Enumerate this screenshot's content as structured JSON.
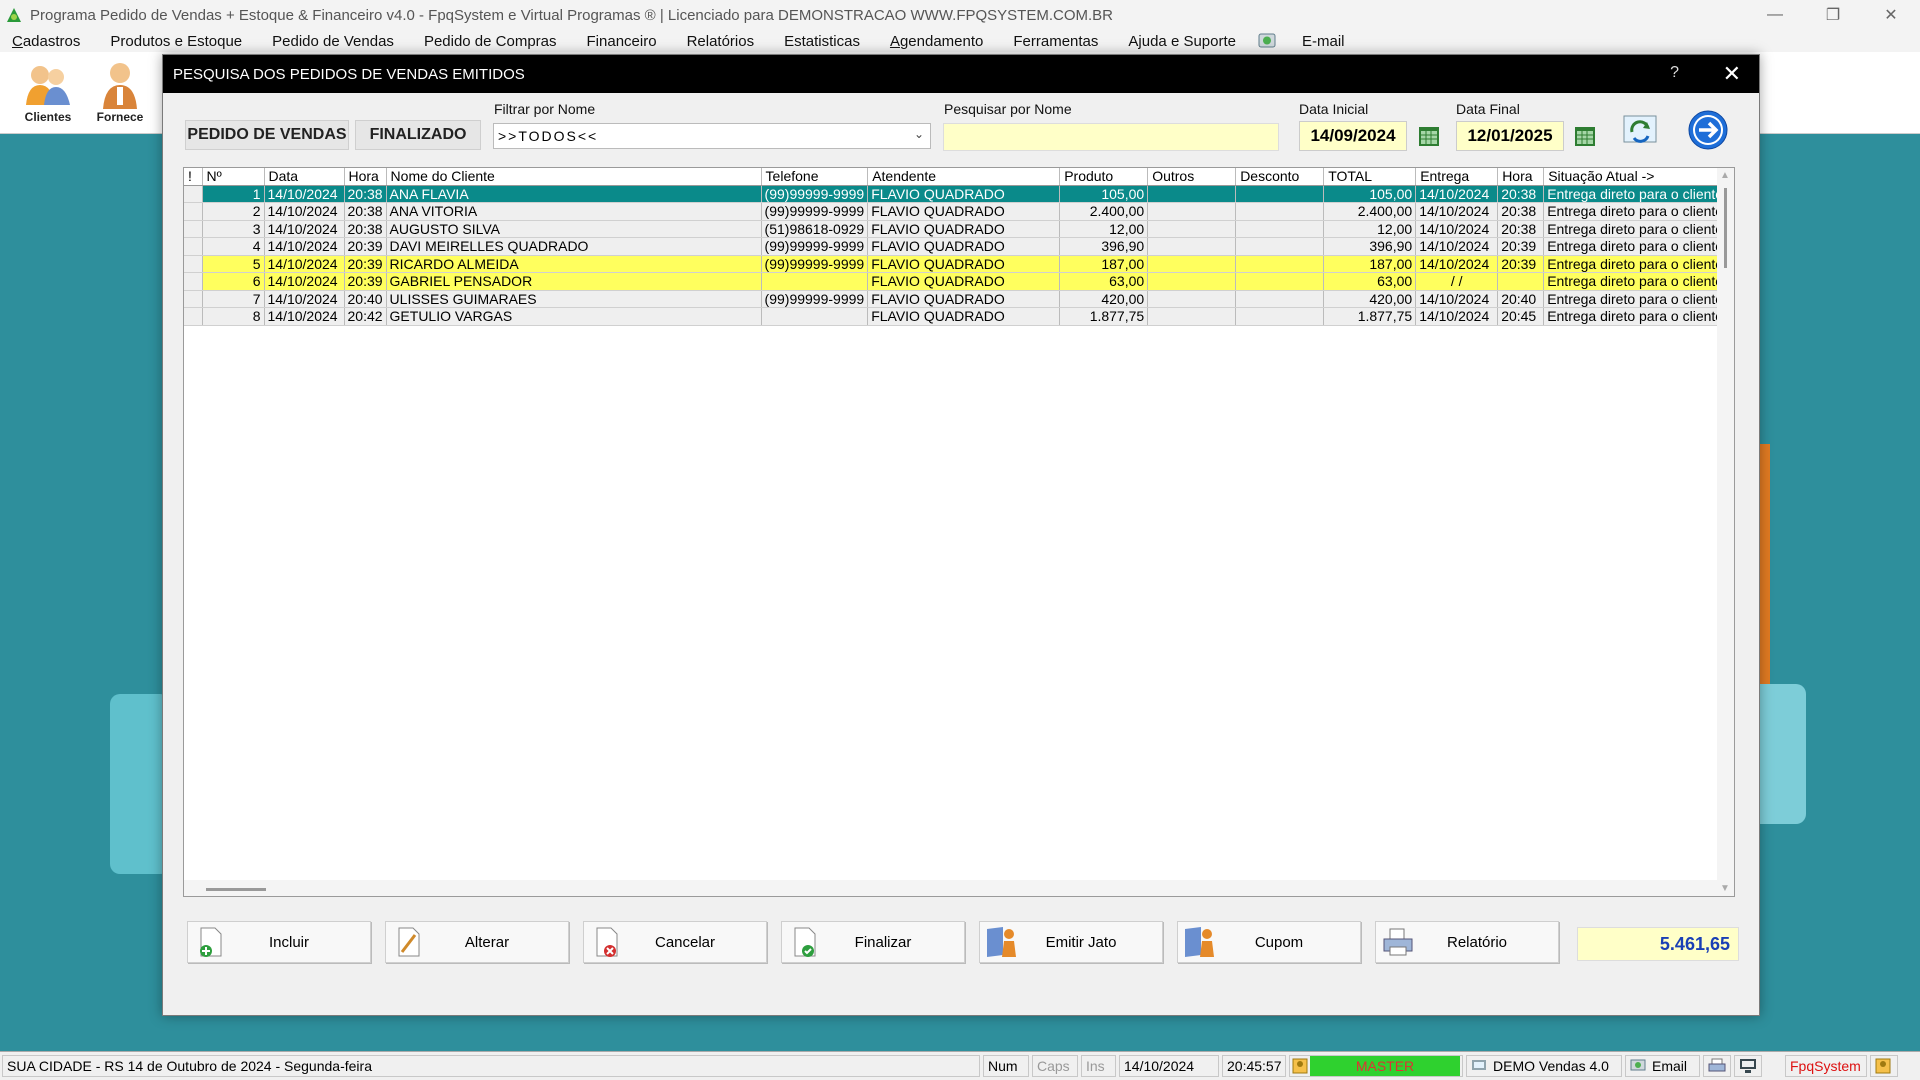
{
  "window": {
    "title": "Programa Pedido de Vendas + Estoque & Financeiro v4.0 - FpqSystem e Virtual Programas ® | Licenciado para  DEMONSTRACAO WWW.FPQSYSTEM.COM.BR"
  },
  "menu": [
    "Cadastros",
    "Produtos e Estoque",
    "Pedido de Vendas",
    "Pedido de Compras",
    "Financeiro",
    "Relatórios",
    "Estatisticas",
    "Agendamento",
    "Ferramentas",
    "Ajuda e Suporte",
    "E-mail"
  ],
  "toolbar": {
    "clientes": "Clientes",
    "fornece": "Fornece"
  },
  "dialog": {
    "title": "PESQUISA DOS PEDIDOS DE VENDAS EMITIDOS",
    "help": "?",
    "close": "✕",
    "btn_pedido": "PEDIDO DE VENDAS",
    "btn_finalizado": "FINALIZADO",
    "filtrar_label": "Filtrar por Nome",
    "filtrar_value": ">>TODOS<<",
    "pesquisar_label": "Pesquisar por Nome",
    "pesquisar_value": "",
    "data_inicial_label": "Data Inicial",
    "data_inicial": "14/09/2024",
    "data_final_label": "Data Final",
    "data_final": "12/01/2025"
  },
  "table": {
    "columns": [
      "!",
      "Nº",
      "Data",
      "Hora",
      "Nome do Cliente",
      "Telefone",
      "Atendente",
      "Produto",
      "Outros",
      "Desconto",
      "TOTAL",
      "Entrega",
      "Hora",
      "Situação Atual ->"
    ],
    "rows": [
      {
        "n": "1",
        "data": "14/10/2024",
        "hora": "20:38",
        "nome": "ANA FLAVIA",
        "tel": "(99)99999-9999",
        "atendente": "FLAVIO QUADRADO",
        "produto": "105,00",
        "outros": "",
        "desconto": "",
        "total": "105,00",
        "entrega": "14/10/2024",
        "hora2": "20:38",
        "situacao": "Entrega direto para o cliente",
        "style": "sel"
      },
      {
        "n": "2",
        "data": "14/10/2024",
        "hora": "20:38",
        "nome": "ANA VITORIA",
        "tel": "(99)99999-9999",
        "atendente": "FLAVIO QUADRADO",
        "produto": "2.400,00",
        "outros": "",
        "desconto": "",
        "total": "2.400,00",
        "entrega": "14/10/2024",
        "hora2": "20:38",
        "situacao": "Entrega direto para o cliente",
        "style": "norm"
      },
      {
        "n": "3",
        "data": "14/10/2024",
        "hora": "20:38",
        "nome": "AUGUSTO SILVA",
        "tel": "(51)98618-0929",
        "atendente": "FLAVIO QUADRADO",
        "produto": "12,00",
        "outros": "",
        "desconto": "",
        "total": "12,00",
        "entrega": "14/10/2024",
        "hora2": "20:38",
        "situacao": "Entrega direto para o cliente",
        "style": "norm"
      },
      {
        "n": "4",
        "data": "14/10/2024",
        "hora": "20:39",
        "nome": "DAVI MEIRELLES QUADRADO",
        "tel": "(99)99999-9999",
        "atendente": "FLAVIO QUADRADO",
        "produto": "396,90",
        "outros": "",
        "desconto": "",
        "total": "396,90",
        "entrega": "14/10/2024",
        "hora2": "20:39",
        "situacao": "Entrega direto para o cliente",
        "style": "norm"
      },
      {
        "n": "5",
        "data": "14/10/2024",
        "hora": "20:39",
        "nome": "RICARDO ALMEIDA",
        "tel": "(99)99999-9999",
        "atendente": "FLAVIO QUADRADO",
        "produto": "187,00",
        "outros": "",
        "desconto": "",
        "total": "187,00",
        "entrega": "14/10/2024",
        "hora2": "20:39",
        "situacao": "Entrega direto para o cliente",
        "style": "yel"
      },
      {
        "n": "6",
        "data": "14/10/2024",
        "hora": "20:39",
        "nome": "GABRIEL PENSADOR",
        "tel": "",
        "atendente": "FLAVIO QUADRADO",
        "produto": "63,00",
        "outros": "",
        "desconto": "",
        "total": "63,00",
        "entrega": "/ /",
        "hora2": "",
        "situacao": "Entrega direto para o cliente",
        "style": "yel"
      },
      {
        "n": "7",
        "data": "14/10/2024",
        "hora": "20:40",
        "nome": "ULISSES GUIMARAES",
        "tel": "(99)99999-9999",
        "atendente": "FLAVIO QUADRADO",
        "produto": "420,00",
        "outros": "",
        "desconto": "",
        "total": "420,00",
        "entrega": "14/10/2024",
        "hora2": "20:40",
        "situacao": "Entrega direto para o cliente",
        "style": "norm"
      },
      {
        "n": "8",
        "data": "14/10/2024",
        "hora": "20:42",
        "nome": "GETULIO VARGAS",
        "tel": "",
        "atendente": "FLAVIO QUADRADO",
        "produto": "1.877,75",
        "outros": "",
        "desconto": "",
        "total": "1.877,75",
        "entrega": "14/10/2024",
        "hora2": "20:45",
        "situacao": "Entrega direto para o cliente",
        "style": "norm"
      }
    ]
  },
  "actions": {
    "incluir": "Incluir",
    "alterar": "Alterar",
    "cancelar": "Cancelar",
    "finalizar": "Finalizar",
    "emitir_jato": "Emitir Jato",
    "cupom": "Cupom",
    "relatorio": "Relatório",
    "total": "5.461,65"
  },
  "statusbar": {
    "location": "SUA CIDADE - RS 14 de Outubro de 2024 - Segunda-feira",
    "num": "Num",
    "caps": "Caps",
    "ins": "Ins",
    "date": "14/10/2024",
    "time": "20:45:57",
    "user": "MASTER",
    "version": "DEMO Vendas 4.0",
    "email": "Email",
    "brand": "FpqSystem"
  },
  "colors": {
    "selected_row": "#0a8a8a",
    "highlight_row": "#ffff5e",
    "field_yellow": "#ffffc8",
    "total_text": "#1a3fb5",
    "desktop": "#2e8f9c"
  }
}
